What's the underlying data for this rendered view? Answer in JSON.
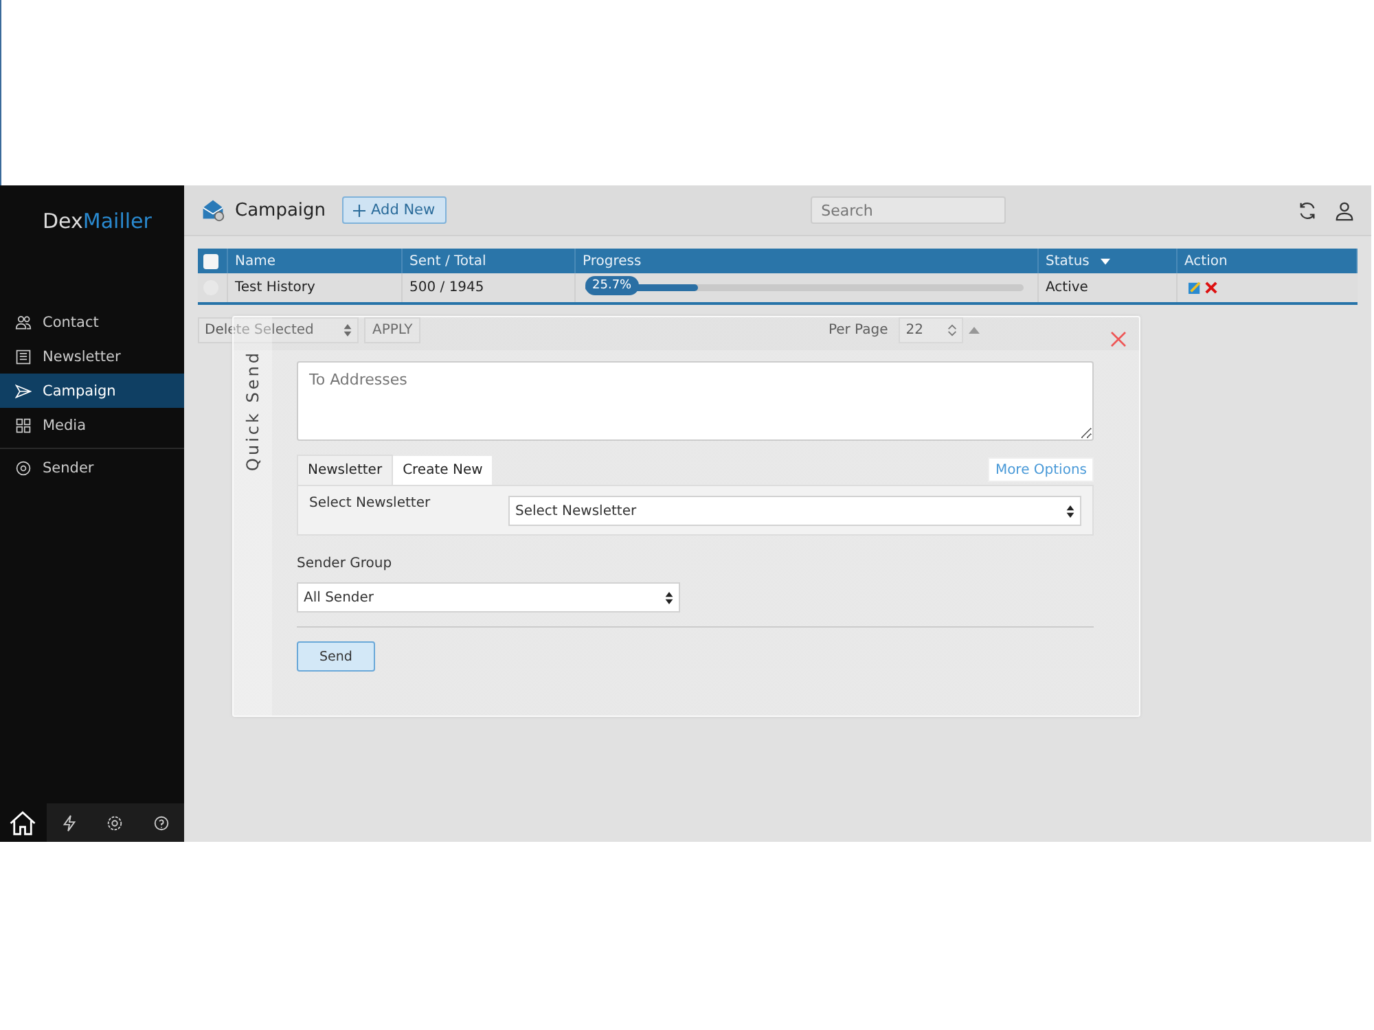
{
  "brand": {
    "part_1": "Dex",
    "part_2": "Mailler"
  },
  "sidebar": {
    "items": [
      {
        "label": "Contact",
        "selected": false
      },
      {
        "label": "Newsletter",
        "selected": false
      },
      {
        "label": "Campaign",
        "selected": true
      },
      {
        "label": "Media",
        "selected": false
      },
      {
        "label": "Sender",
        "selected": false
      }
    ],
    "bottom_bar": [
      {
        "selected": true
      },
      {
        "selected": false
      },
      {
        "selected": false
      },
      {
        "selected": false
      }
    ]
  },
  "header": {
    "title": "Campaign",
    "add_button": "Add New",
    "search_placeholder": "Search"
  },
  "table": {
    "all_checked": false,
    "columns": [
      "Name",
      "Sent / Total",
      "Progress",
      "Status",
      "Action"
    ],
    "rows": [
      {
        "checked": false,
        "name": "Test History",
        "sent_total": "500 / 1945",
        "level": 0.257,
        "progress_label": "25.7%",
        "status": "Active"
      }
    ]
  },
  "toolbar": {
    "bulk_action": "Delete Selected",
    "apply": "APPLY",
    "per_page_label": "Per Page",
    "per_page": "22"
  },
  "quick_send": {
    "title": "Quick Send",
    "to_placeholder": "To Addresses",
    "tabs": [
      {
        "label": "Newsletter",
        "selected": true
      },
      {
        "label": "Create New",
        "selected": false
      }
    ],
    "more_options": "More Options",
    "newsletter_label": "Select Newsletter",
    "newsletter_value": "Select Newsletter",
    "sender_group_label": "Sender Group",
    "sender_group_value": "All Sender",
    "send": "Send"
  }
}
